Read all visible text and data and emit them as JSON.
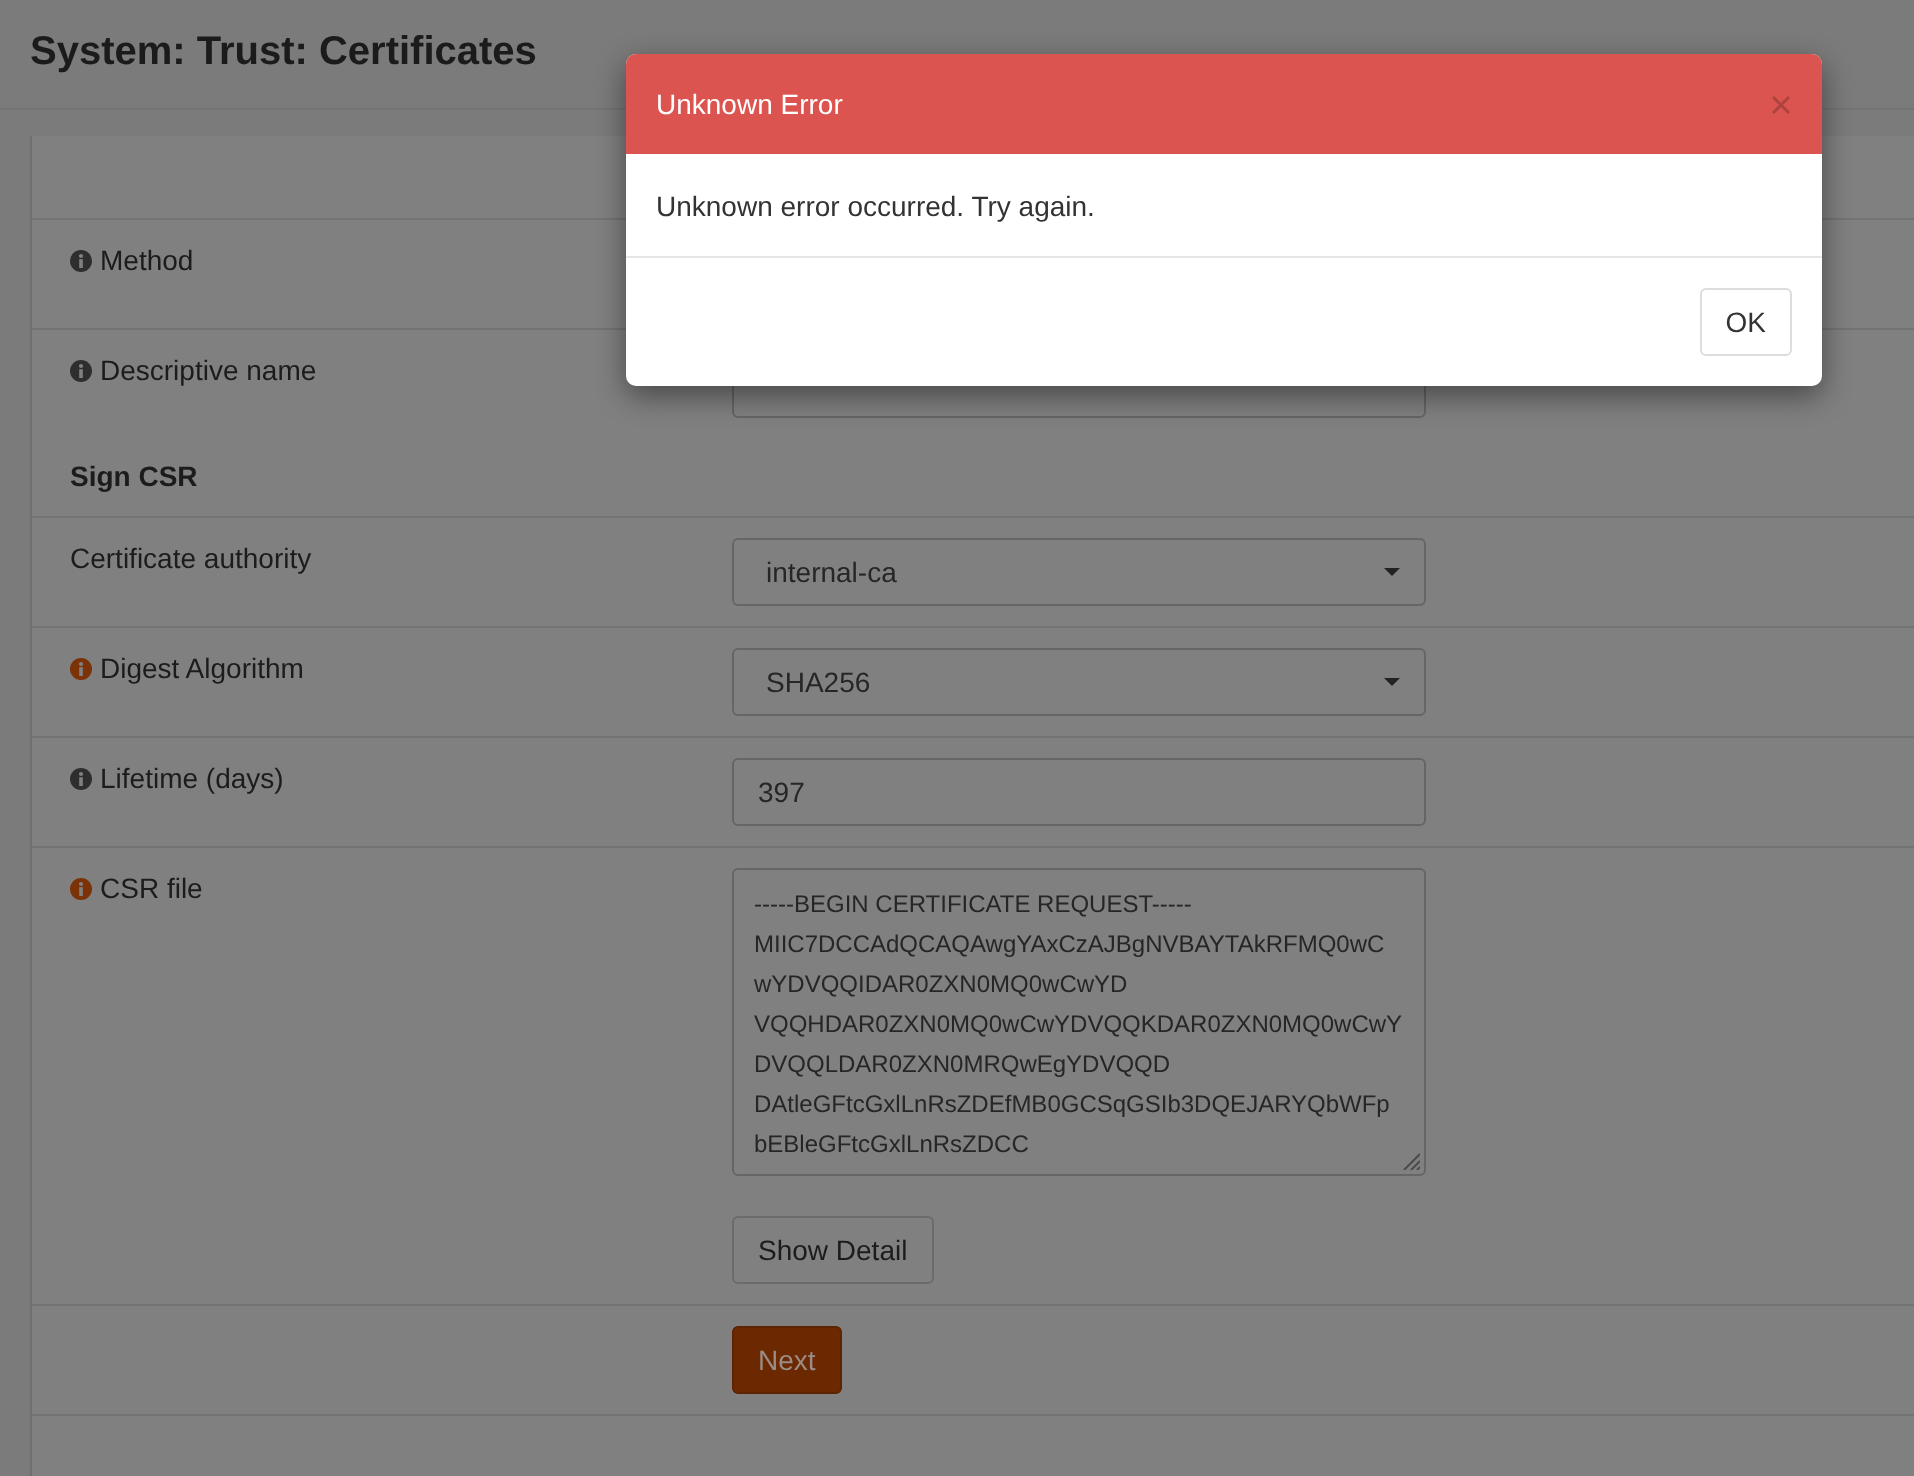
{
  "page": {
    "title": "System: Trust: Certificates"
  },
  "form": {
    "rows": [
      {
        "kind": "label",
        "label": "Method",
        "color": "#2e2e2e"
      },
      {
        "kind": "input",
        "label": "Descriptive name",
        "color": "#2e2e2e"
      },
      {
        "kind": "section",
        "label": "Sign CSR"
      },
      {
        "kind": "select",
        "label": "Certificate authority",
        "value": "internal-ca"
      },
      {
        "kind": "select",
        "label": "Digest Algorithm",
        "color": "#7a3206",
        "value": "SHA256"
      },
      {
        "kind": "input",
        "label": "Lifetime (days)",
        "color": "#2e2e2e",
        "value": "397"
      },
      {
        "kind": "textarea",
        "label": "CSR file",
        "color": "#7a3206",
        "lines": [
          "-----BEGIN CERTIFICATE REQUEST-----",
          "MIIC7DCCAdQCAQAwgYAxCzAJBgNVBAYTAkRFMQ0wC",
          "wYDVQQIDAR0ZXN0MQ0wCwYD",
          "VQQHDAR0ZXN0MQ0wCwYDVQQKDAR0ZXN0MQ0wCwY",
          "DVQQLDAR0ZXN0MRQwEgYDVQQD",
          "DAtleGFtcGxlLnRsZDEfMB0GCSqGSIb3DQEJARYQbWFp",
          "bEBleGFtcGxlLnRsZDCC"
        ],
        "button": "Show Detail"
      },
      {
        "kind": "submit",
        "button": "Next"
      }
    ]
  },
  "modal": {
    "title": "Unknown Error",
    "message": "Unknown error occurred. Try again.",
    "buttons": [
      "OK"
    ]
  }
}
